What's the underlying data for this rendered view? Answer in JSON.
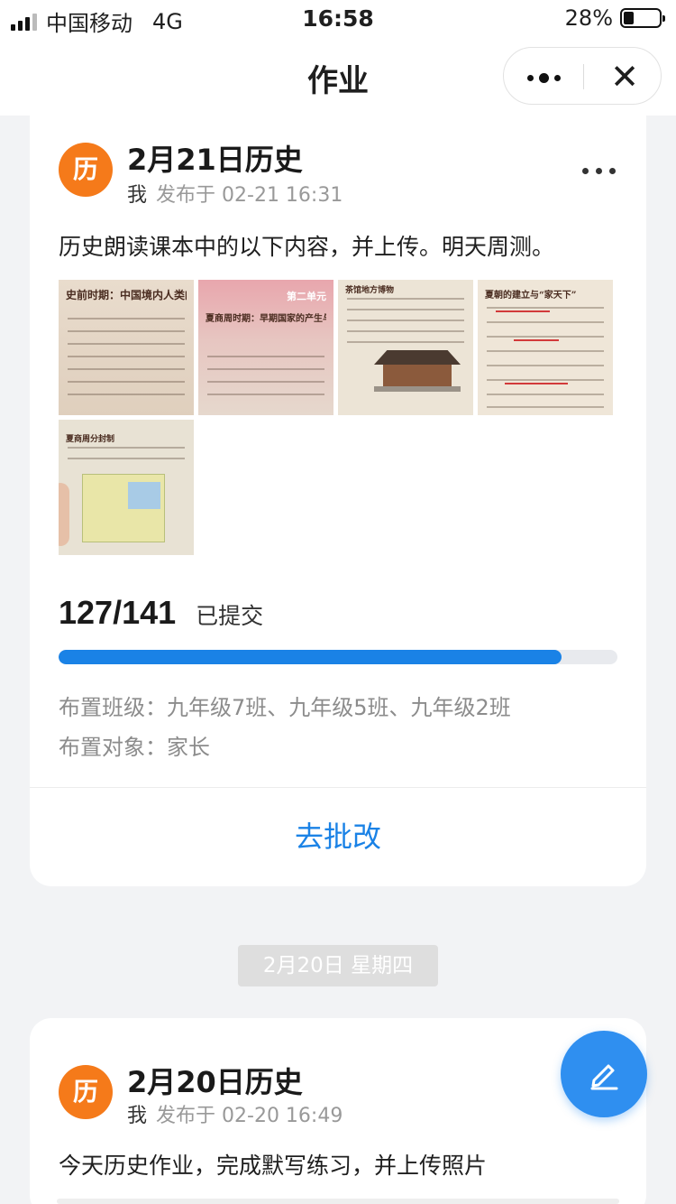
{
  "status_bar": {
    "carrier": "中国移动",
    "network": "4G",
    "time": "16:58",
    "battery_percent": "28%",
    "battery_level": 0.28
  },
  "nav": {
    "title": "作业",
    "more_icon": "more-dots-icon",
    "close_icon": "close-icon",
    "close_glyph": "✕"
  },
  "homework_1": {
    "avatar_text": "历",
    "title": "2月21日历史",
    "author": "我",
    "published": "发布于 02-21 16:31",
    "description": "历史朗读课本中的以下内容，并上传。明天周测。",
    "photos": [
      {
        "header": "史前时期：中国境内人类的活动"
      },
      {
        "header": "夏商周时期：早期国家的产生与社会变革",
        "unit": "第二单元"
      },
      {
        "header": "茶馆地方博物"
      },
      {
        "header": "夏朝的建立与“家天下”"
      },
      {
        "header": "夏商周分封制"
      }
    ],
    "submitted": 127,
    "total": 141,
    "count_text": "127/141",
    "count_label": "已提交",
    "progress_fraction": 0.9007,
    "classes_text": "布置班级：九年级7班、九年级5班、九年级2班",
    "target_text": "布置对象：家长",
    "action_label": "去批改"
  },
  "date_separator": "2月20日 星期四",
  "homework_2": {
    "avatar_text": "历",
    "title": "2月20日历史",
    "author": "我",
    "published": "发布于 02-20 16:49",
    "description": "今天历史作业，完成默写练习，并上传照片"
  },
  "fab_icon": "edit-pencil-icon",
  "colors": {
    "accent": "#1a82e6",
    "avatar": "#f57a1a",
    "fab": "#2f8ff0"
  }
}
